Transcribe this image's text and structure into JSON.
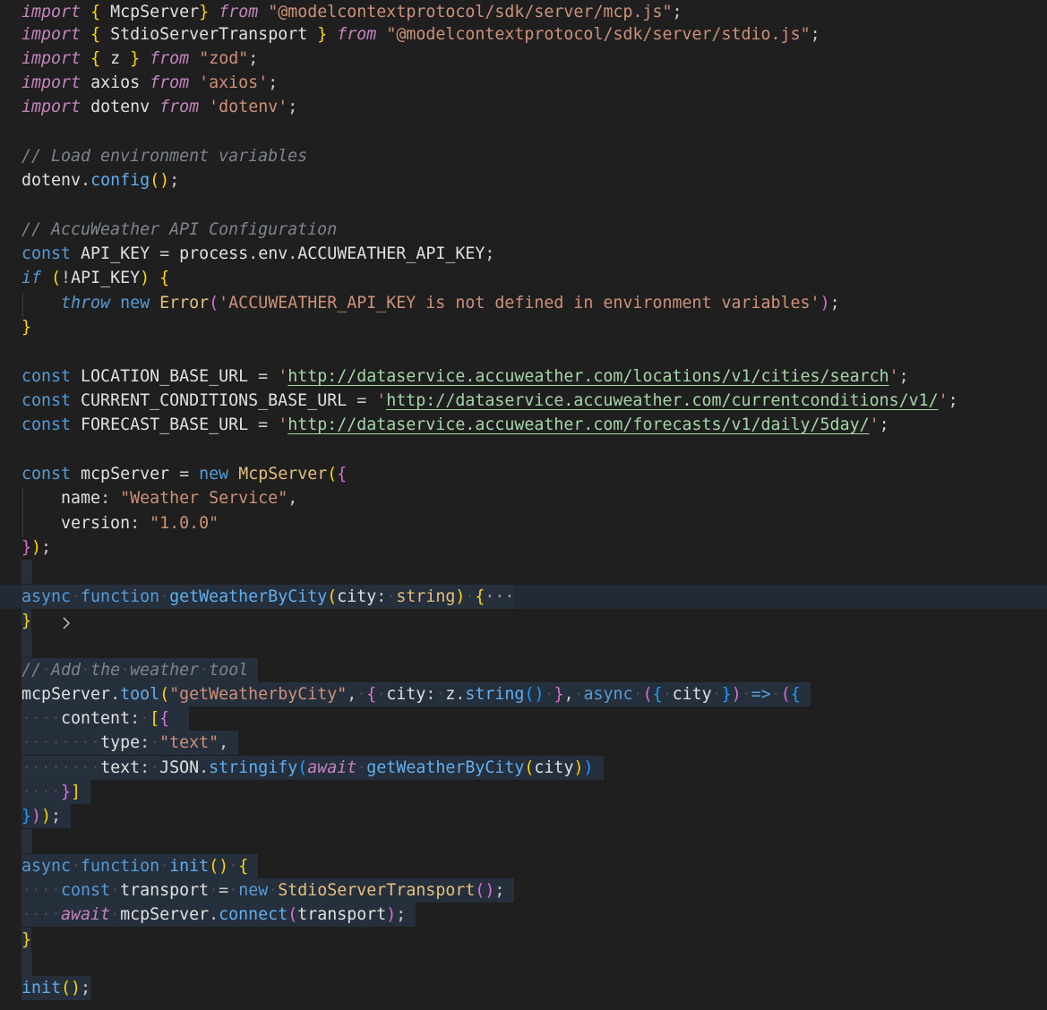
{
  "editor": {
    "language": "typescript",
    "lines": [
      "import { McpServer} from \"@modelcontextprotocol/sdk/server/mcp.js\";",
      "import { StdioServerTransport } from \"@modelcontextprotocol/sdk/server/stdio.js\";",
      "import { z } from \"zod\";",
      "import axios from 'axios';",
      "import dotenv from 'dotenv';",
      "",
      "// Load environment variables",
      "dotenv.config();",
      "",
      "// AccuWeather API Configuration",
      "const API_KEY = process.env.ACCUWEATHER_API_KEY;",
      "if (!API_KEY) {",
      "    throw new Error('ACCUWEATHER_API_KEY is not defined in environment variables');",
      "}",
      "",
      "const LOCATION_BASE_URL = 'http://dataservice.accuweather.com/locations/v1/cities/search';",
      "const CURRENT_CONDITIONS_BASE_URL = 'http://dataservice.accuweather.com/currentconditions/v1/';",
      "const FORECAST_BASE_URL = 'http://dataservice.accuweather.com/forecasts/v1/daily/5day/';",
      "",
      "const mcpServer = new McpServer({",
      "    name: \"Weather Service\",",
      "    version: \"1.0.0\"",
      "});",
      "",
      "async function getWeatherByCity(city: string) {···",
      "}",
      "",
      "// Add the weather tool",
      "mcpServer.tool(\"getWeatherbyCity\", { city: z.string() }, async ({ city }) => ({",
      "    content: [{",
      "        type: \"text\",",
      "        text: JSON.stringify(await getWeatherByCity(city))",
      "    }]",
      "}));",
      "",
      "async function init() {",
      "    const transport = new StdioServerTransport();",
      "    await mcpServer.connect(transport);",
      "}",
      "",
      "init();"
    ],
    "folded_line_marker": "···",
    "colors": {
      "background": "#1f1f1f",
      "selection": "#262f3c",
      "keyword": "#569cd6",
      "control_keyword": "#c586c0",
      "string": "#ce9178",
      "comment": "#6a9955",
      "function": "#61afef",
      "class": "#e5c07b",
      "bracket_level_1": "#ffd700",
      "bracket_level_2": "#da70d6",
      "bracket_level_3": "#179fff"
    },
    "icons": {
      "fold": "chevron-right-icon"
    }
  }
}
